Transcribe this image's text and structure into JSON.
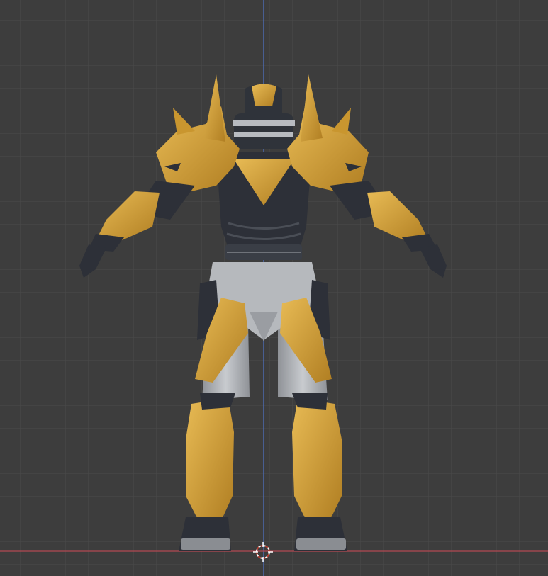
{
  "viewport": {
    "view": "3d-viewport-front-ortho",
    "background_color": "#3d3d3d",
    "grid_color_minor": "#4a4a4a",
    "grid_color_major": "#555555",
    "z_axis_color": "#4f74c9",
    "x_axis_color": "#b34a52",
    "cursor_color_primary": "#ffffff",
    "cursor_color_secondary": "#c0392b"
  },
  "model": {
    "name_visible": "",
    "armor_gold": "#c9962f",
    "armor_gold_light": "#e2b24c",
    "body_dark": "#2d3038",
    "body_gray": "#b9bcc0",
    "body_gray_dark": "#8a8d92"
  }
}
